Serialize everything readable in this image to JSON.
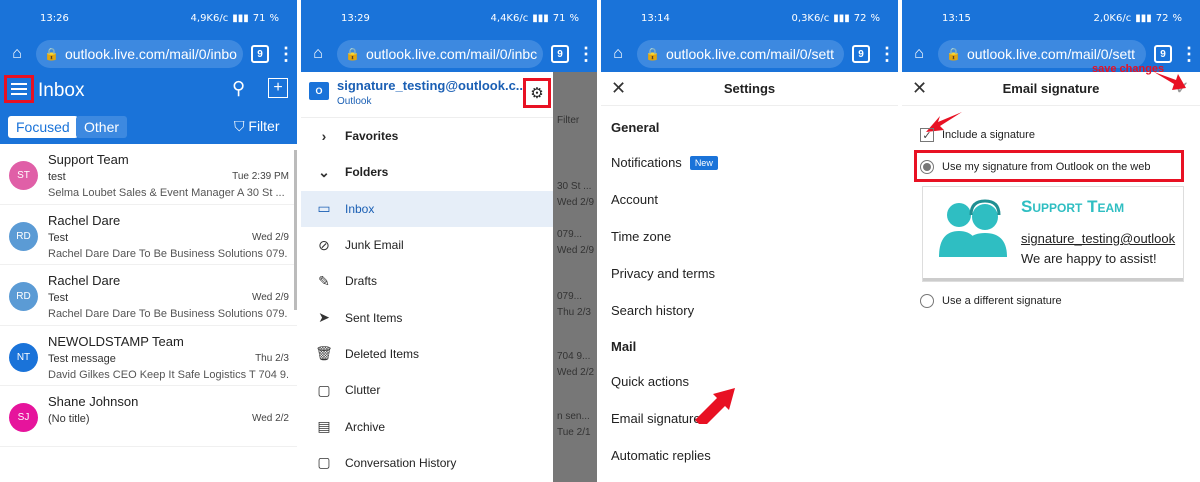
{
  "panels": [
    {
      "status": {
        "time": "13:26",
        "net": "4,9K6/c",
        "battery": "71"
      },
      "url": "outlook.live.com/mail/0/inbo",
      "tabs": "9",
      "title": "Inbox",
      "focused": "Focused",
      "other": "Other",
      "filter": "Filter",
      "mails": [
        {
          "initials": "ST",
          "color": "#e05fa7",
          "from": "Support Team",
          "subject": "test",
          "date": "Tue 2:39 PM",
          "preview": "Selma Loubet Sales & Event Manager A 30 St ..."
        },
        {
          "initials": "RD",
          "color": "#5b9bd5",
          "from": "Rachel Dare",
          "subject": "Test",
          "date": "Wed 2/9",
          "preview": "Rachel Dare Dare To Be Business Solutions 079..."
        },
        {
          "initials": "RD",
          "color": "#5b9bd5",
          "from": "Rachel Dare",
          "subject": "Test",
          "date": "Wed 2/9",
          "preview": "Rachel Dare Dare To Be Business Solutions 079..."
        },
        {
          "initials": "NT",
          "color": "#1a73d9",
          "from": "NEWOLDSTAMP Team",
          "subject": "Test message",
          "date": "Thu 2/3",
          "preview": "David Gilkes CEO Keep It Safe Logistics T 704 9..."
        },
        {
          "initials": "SJ",
          "color": "#e6149c",
          "from": "Shane Johnson",
          "subject": "(No title)",
          "date": "Wed 2/2",
          "preview": ""
        }
      ]
    },
    {
      "status": {
        "time": "13:29",
        "net": "4,4K6/c",
        "battery": "71"
      },
      "url": "outlook.live.com/mail/0/inbc",
      "tabs": "9",
      "account_email": "signature_testing@outlook.c...",
      "account_sub": "Outlook",
      "folders": [
        "Favorites",
        "Folders",
        "Inbox",
        "Junk Email",
        "Drafts",
        "Sent Items",
        "Deleted Items",
        "Clutter",
        "Archive",
        "Conversation History"
      ],
      "shade_text": [
        "Filter",
        "30 St ...",
        "Wed 2/9",
        "079...",
        "Wed 2/9",
        "079...",
        "Thu 2/3",
        "704 9...",
        "Wed 2/2",
        "n sen...",
        "Tue 2/1"
      ]
    },
    {
      "status": {
        "time": "13:14",
        "net": "0,3K6/c",
        "battery": "72"
      },
      "url": "outlook.live.com/mail/0/sett",
      "tabs": "9",
      "title": "Settings",
      "general": "General",
      "items_general": [
        "Notifications",
        "Account",
        "Time zone",
        "Privacy and terms",
        "Search history"
      ],
      "new_badge": "New",
      "mail": "Mail",
      "items_mail": [
        "Quick actions",
        "Email signature",
        "Automatic replies"
      ]
    },
    {
      "status": {
        "time": "13:15",
        "net": "2,0K6/c",
        "battery": "72"
      },
      "url": "outlook.live.com/mail/0/sett",
      "tabs": "9",
      "title": "Email signature",
      "save_changes": "save changes",
      "include": "Include a signature",
      "use_outlook": "Use my signature from Outlook on the web",
      "use_different": "Use a different signature",
      "sig_team": "Support Team",
      "sig_email": "signature_testing@outlook",
      "sig_text": "We are happy to assist!"
    }
  ],
  "colors": {
    "accent": "#1a73d9",
    "highlight": "#e81123",
    "sig_teal": "#2fbec2"
  }
}
